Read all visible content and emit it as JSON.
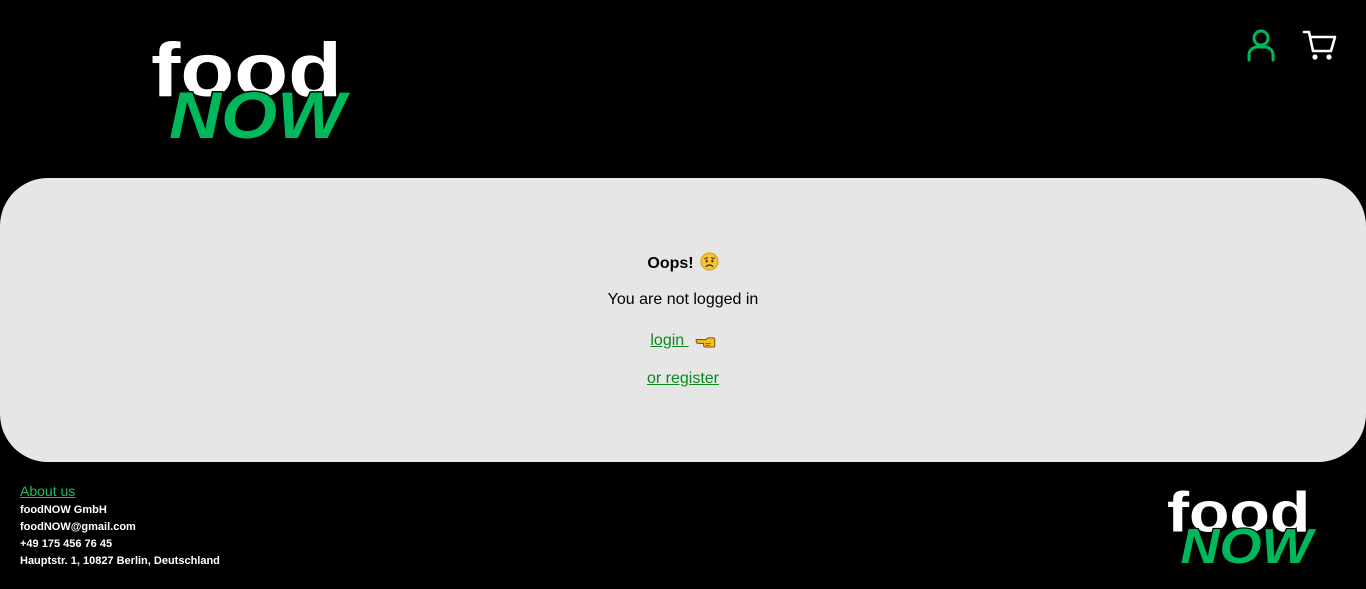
{
  "brand": {
    "logo_top": "food",
    "logo_bottom": "NOW",
    "colors": {
      "green": "#00b85c",
      "white": "#ffffff",
      "background": "#000000",
      "panel": "#e6e6e6",
      "link": "#0a8a1c"
    }
  },
  "header": {
    "icons": {
      "account": "user-icon",
      "cart": "cart-icon"
    }
  },
  "main": {
    "title": "Oops!",
    "title_emoji": "disappointed-relieved-face-icon",
    "message": "You are not logged in",
    "login_label": "login",
    "login_emoji": "pointing-left-hand-icon",
    "register_label": "or register"
  },
  "footer": {
    "about_label": "About us",
    "company": "foodNOW GmbH",
    "email": "foodNOW@gmail.com",
    "phone": "+49 175 456 76 45",
    "address": "Hauptstr. 1, 10827 Berlin, Deutschland"
  }
}
